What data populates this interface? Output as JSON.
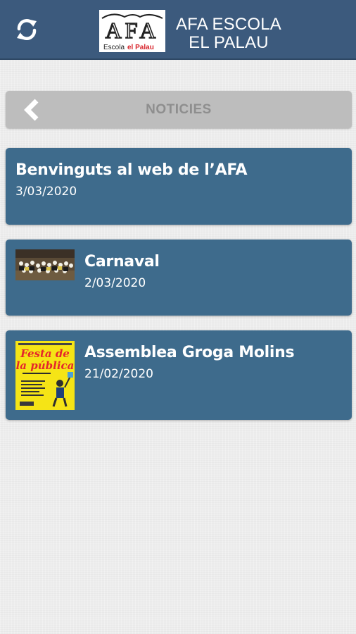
{
  "header": {
    "refresh_icon": "refresh-icon",
    "logo_letters": "AFA",
    "logo_sub_1": "Escola",
    "logo_sub_2": "el Palau",
    "title_line1": "AFA ESCOLA",
    "title_line2": "EL PALAU",
    "color": "#3c5a7d"
  },
  "section": {
    "back_icon": "chevron-left-icon",
    "title": "NOTICIES"
  },
  "news": [
    {
      "title": "Benvinguts al web de l’AFA",
      "date": "3/03/2020"
    },
    {
      "title": "Carnaval",
      "date": "2/03/2020",
      "thumbnail": "group-photo"
    },
    {
      "title": "Assemblea Groga Molins",
      "date": "21/02/2020",
      "thumbnail": "yellow-poster",
      "poster_line1": "Festa de",
      "poster_line2": "la pública"
    }
  ],
  "colors": {
    "card": "#3e6b8c",
    "section_bar": "#bdbdbd",
    "poster_bg": "#f5e416",
    "poster_text": "#e4262c"
  }
}
